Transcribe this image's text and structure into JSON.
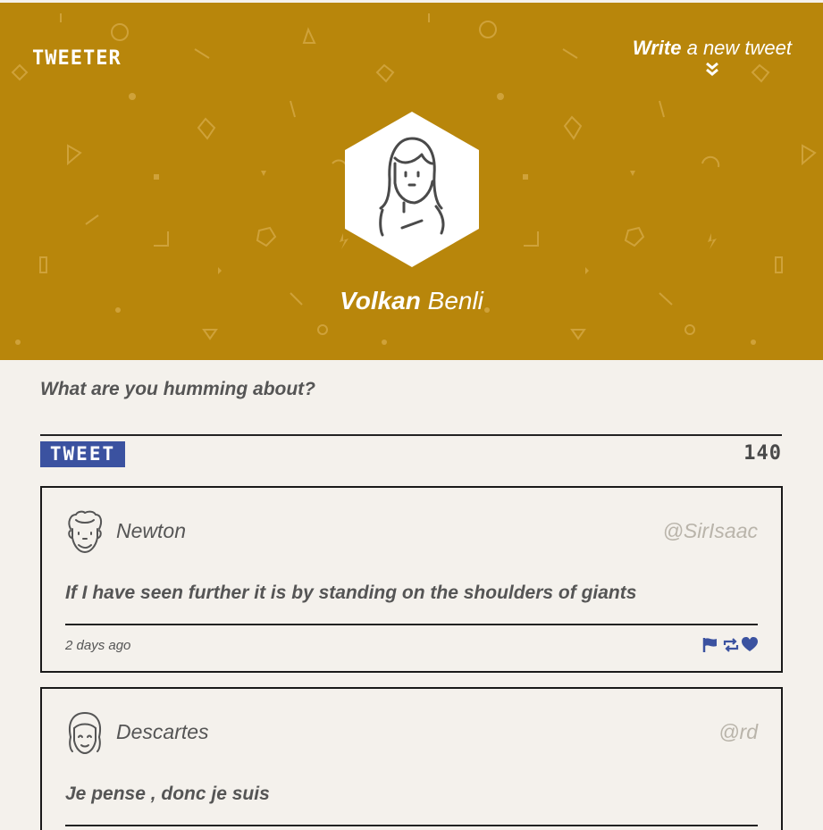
{
  "brand": "TWEETER",
  "header": {
    "write_link_bold": "Write",
    "write_link_rest": " a new tweet",
    "profile_first": "Volkan",
    "profile_last": " Benli",
    "bg_color": "#b8860b"
  },
  "compose": {
    "prompt": "What are you humming about?",
    "button_label": "TWEET",
    "char_count": "140",
    "accent_color": "#3b52a0"
  },
  "tweets": [
    {
      "name": "Newton",
      "handle": "@SirIsaac",
      "text": "If I have seen further it is by standing on the shoulders of giants",
      "time": "2 days ago",
      "avatar_icon": "man-avatar-icon",
      "actions": [
        "flag-icon",
        "retweet-icon",
        "heart-icon"
      ]
    },
    {
      "name": "Descartes",
      "handle": "@rd",
      "text": "Je pense , donc je suis",
      "avatar_icon": "woman-avatar-icon"
    }
  ]
}
